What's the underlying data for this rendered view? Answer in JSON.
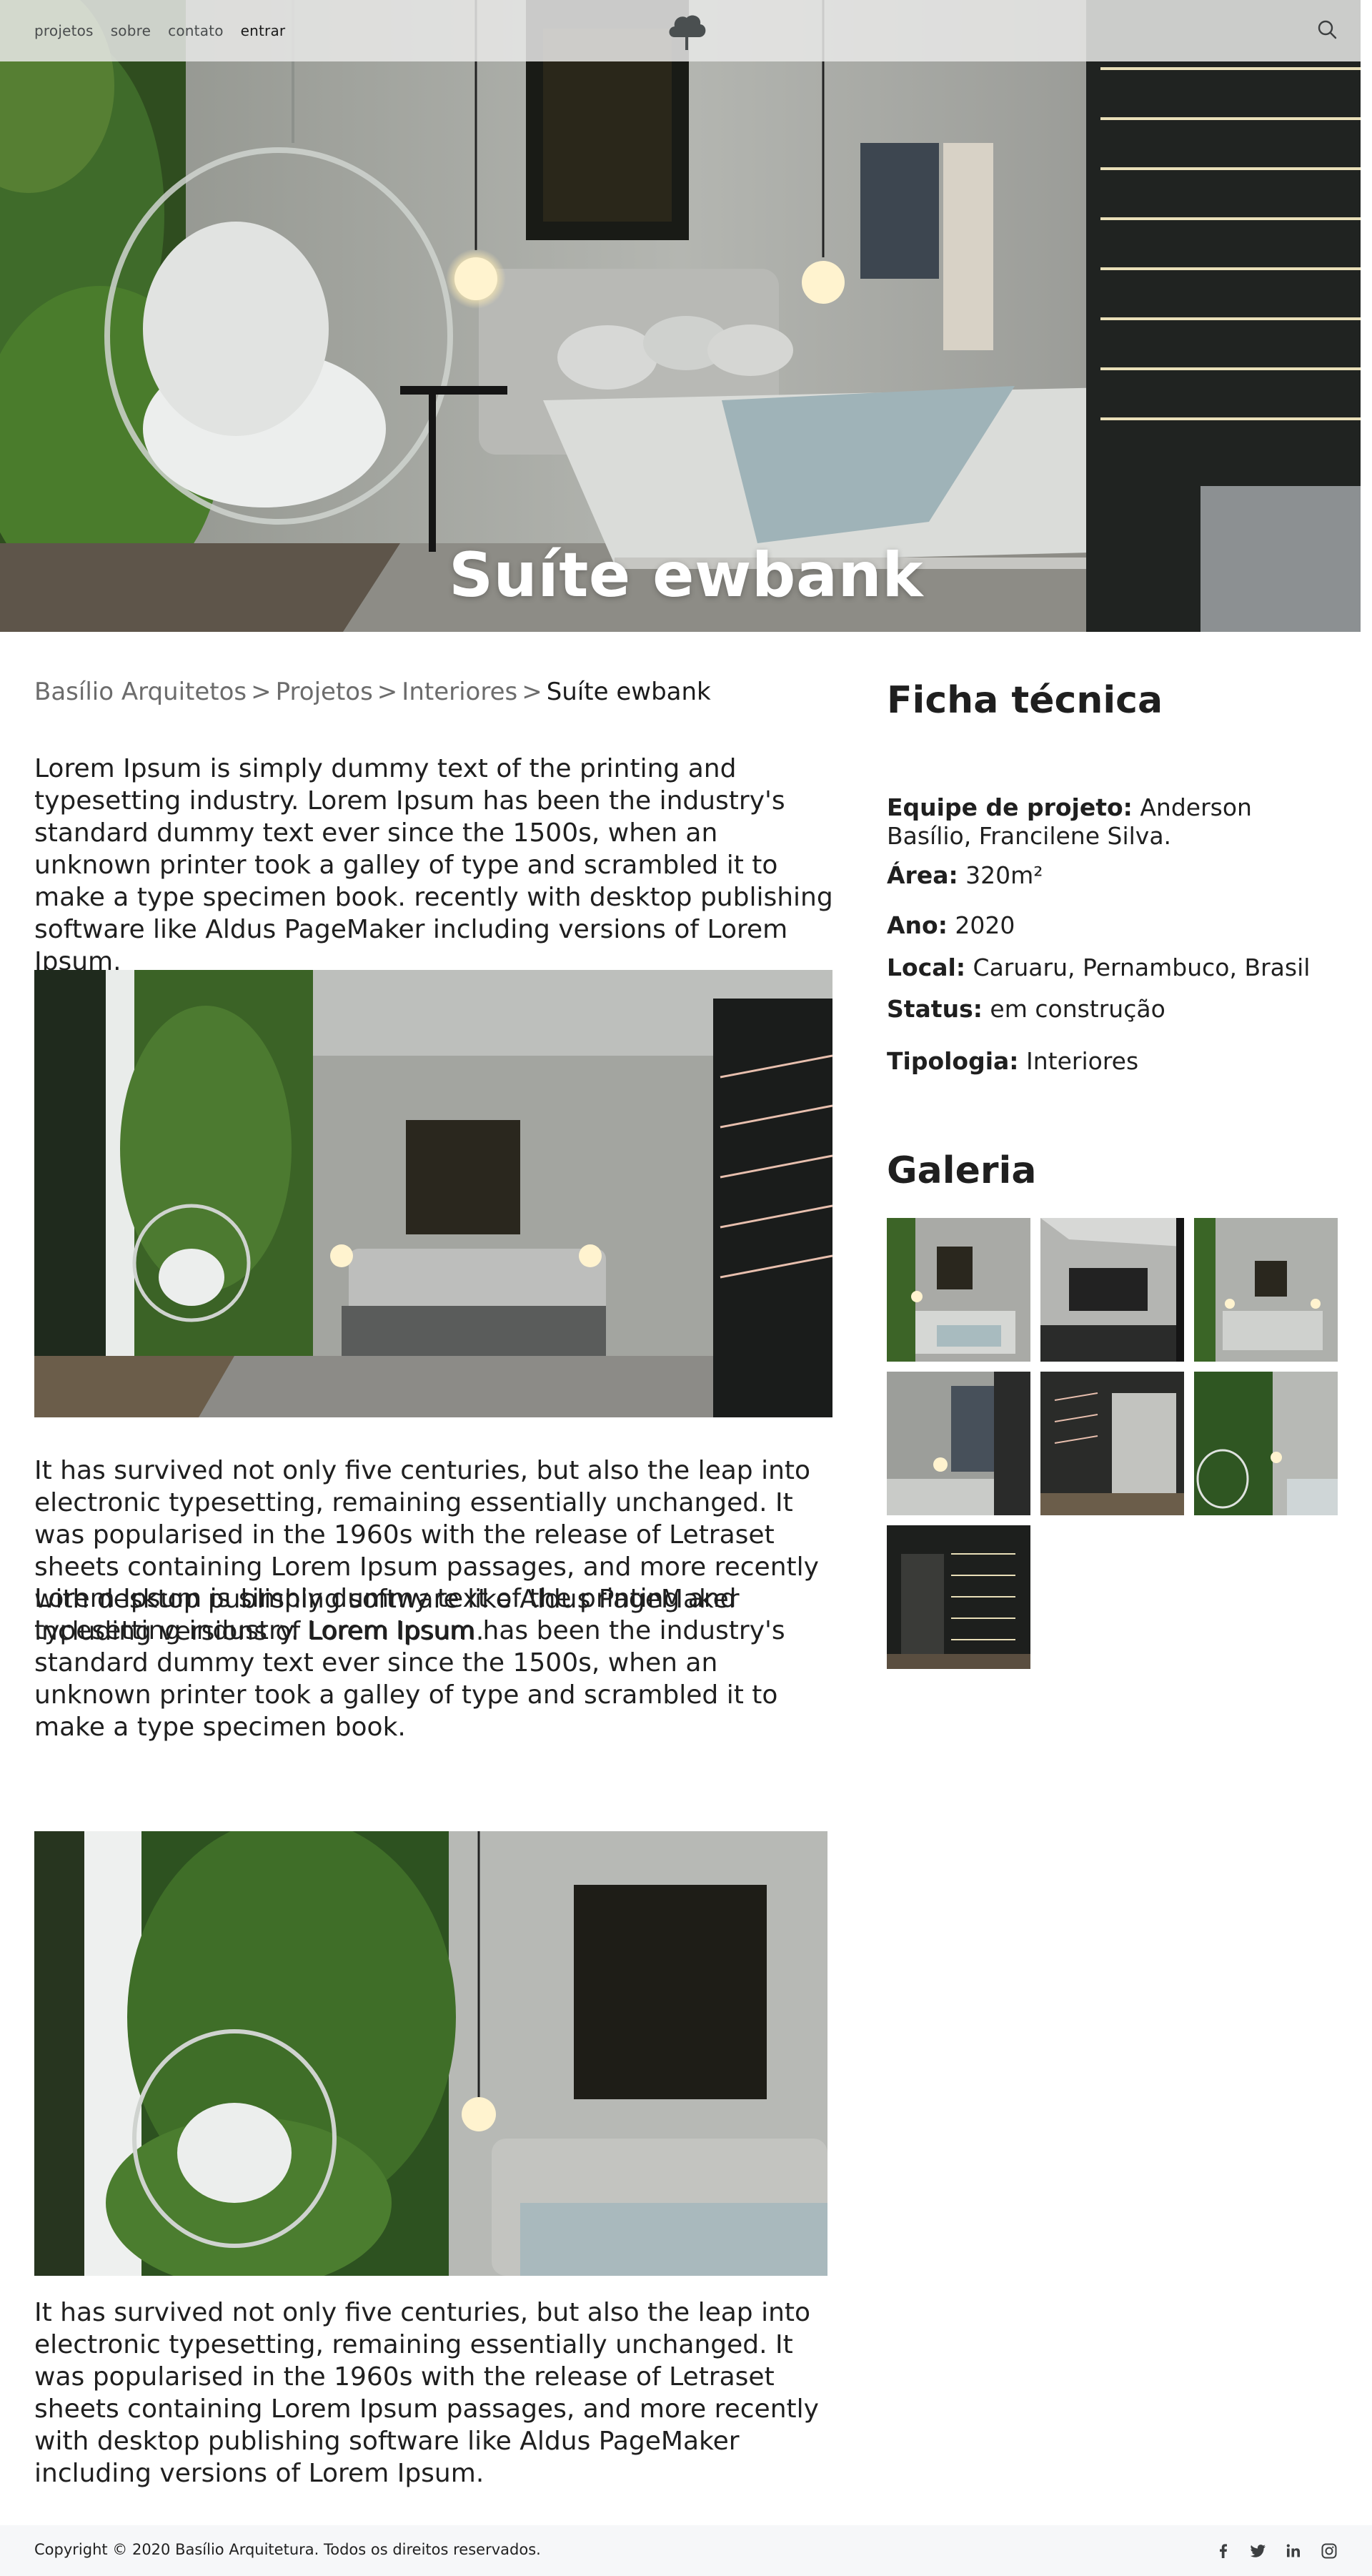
{
  "nav": {
    "items": [
      "projetos",
      "sobre",
      "contato"
    ],
    "login": "entrar"
  },
  "icons": {
    "logo": "tree-logo-icon",
    "search": "search-icon",
    "social": [
      "facebook-icon",
      "twitter-icon",
      "linkedin-icon",
      "instagram-icon"
    ]
  },
  "hero": {
    "title": "Suíte ewbank"
  },
  "breadcrumb": {
    "items": [
      "Basílio Arquitetos",
      "Projetos",
      "Interiores"
    ],
    "separator": ">",
    "current": "Suíte ewbank"
  },
  "content": {
    "paragraph1": "Lorem Ipsum is simply dummy text of the printing and typesetting industry. Lorem Ipsum has been the industry's standard dummy text ever since the 1500s, when an unknown printer took a galley of type and scrambled it to make a type specimen book. recently with desktop publishing software like Aldus PageMaker including versions of Lorem Ipsum.",
    "paragraph2": "It has survived not only five centuries, but also the leap into electronic typesetting, remaining essentially unchanged. It was popularised in the 1960s with the release of Letraset sheets containing Lorem Ipsum passages, and more recently with desktop publishing software like Aldus PageMaker including versions of Lorem Ipsum.",
    "paragraph3": "Lorem Ipsum is simply dummy text of the printing and typesetting industry. Lorem Ipsum has been the industry's standard dummy text ever since the 1500s, when an unknown printer took a galley of type and scrambled it to make a type specimen book.",
    "paragraph4": "It has survived not only five centuries, but also the leap into electronic typesetting, remaining essentially unchanged. It was popularised in the 1960s with the release of Letraset sheets containing Lorem Ipsum passages, and more recently with desktop publishing software like Aldus PageMaker including versions of Lorem Ipsum."
  },
  "sidebar": {
    "spec_title": "Ficha técnica",
    "specs": [
      {
        "label": "Equipe de projeto:",
        "value": "Anderson Basílio, Francilene Silva."
      },
      {
        "label": "Área:",
        "value": "320m²"
      },
      {
        "label": "Ano:",
        "value": "2020"
      },
      {
        "label": "Local:",
        "value": "Caruaru, Pernambuco, Brasil"
      },
      {
        "label": "Status:",
        "value": "em construção"
      },
      {
        "label": "Tipologia:",
        "value": "Interiores"
      }
    ],
    "gallery_title": "Galeria",
    "gallery_count": 7
  },
  "footer": {
    "copyright": "Copyright © 2020 Basílio Arquitetura. Todos os direitos reservados."
  },
  "colors": {
    "text": "#1f1f1f",
    "muted": "#6c6c6c",
    "header_bg": "#e8e8e6",
    "footer_bg": "#f6f7f9",
    "foliage": "#3f6b2a"
  }
}
